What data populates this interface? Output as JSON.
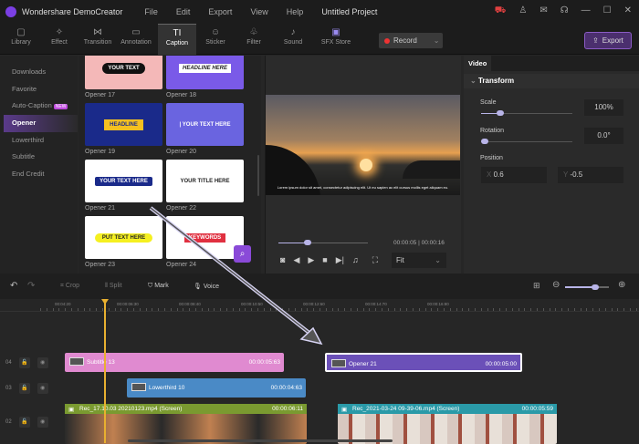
{
  "titlebar": {
    "app": "Wondershare DemoCreator",
    "menu": [
      "File",
      "Edit",
      "Export",
      "View",
      "Help"
    ],
    "project": "Untitled Project",
    "icons": [
      "cart-icon",
      "user-icon",
      "mail-icon",
      "support-icon",
      "minimize-icon",
      "maximize-icon",
      "close-icon"
    ]
  },
  "toolbar": {
    "tools": [
      {
        "label": "Library",
        "icon": "▢"
      },
      {
        "label": "Effect",
        "icon": "✧"
      },
      {
        "label": "Transition",
        "icon": "⋈"
      },
      {
        "label": "Annotation",
        "icon": "▭"
      },
      {
        "label": "Caption",
        "icon": "TI"
      },
      {
        "label": "Sticker",
        "icon": "☺"
      },
      {
        "label": "Filter",
        "icon": "♧"
      },
      {
        "label": "Sound",
        "icon": "♪"
      },
      {
        "label": "SFX Store",
        "icon": "▣"
      }
    ],
    "active": "Caption",
    "record": "Record",
    "export": "Export"
  },
  "sidebar": {
    "items": [
      "Downloads",
      "Favorite",
      "Auto-Caption",
      "Opener",
      "Lowerthird",
      "Subtitle",
      "End Credit"
    ],
    "new_badge": "NEW",
    "active": "Opener"
  },
  "cards": [
    {
      "label": "Opener 17",
      "text": "YOUR TEXT",
      "bg": "#f4b8b8",
      "fg": "#fff"
    },
    {
      "label": "Opener 18",
      "text": "HEADLINE HERE",
      "bg": "#7a5ae8",
      "fg": "#222"
    },
    {
      "label": "Opener 19",
      "text": "HEADLINE",
      "bg": "#1a2a8a",
      "fg": "#f5c020"
    },
    {
      "label": "Opener 20",
      "text": "| YOUR TEXT HERE",
      "bg": "#6a64e0",
      "fg": "#fff"
    },
    {
      "label": "Opener 21",
      "text": "YOUR TEXT HERE",
      "bg": "#ffffff",
      "fg": "#1a2a8a"
    },
    {
      "label": "Opener 22",
      "text": "YOUR TITLE HERE",
      "bg": "#ffffff",
      "fg": "#222"
    },
    {
      "label": "Opener 23",
      "text": "PUT TEXT HERE",
      "bg": "#ffffff",
      "fg": "#222"
    },
    {
      "label": "Opener 24",
      "text": "KEYWORDS",
      "bg": "#ffffff",
      "fg": "#e03040"
    }
  ],
  "preview": {
    "subtitle": "Lorem ipsum dolor sit amet, consectetur adipiscing elit. Ut eu sapien ac elit cursus mollis eget aliquam eu.",
    "current": "00:00:05",
    "total": "00:00:16",
    "progress": 0.33,
    "fit": "Fit"
  },
  "props": {
    "tab": "Video",
    "section": "Transform",
    "scale_label": "Scale",
    "scale": "100%",
    "rotation_label": "Rotation",
    "rotation": "0.0°",
    "position_label": "Position",
    "x_label": "X",
    "x": "0.6",
    "y_label": "Y",
    "y": "-0.5"
  },
  "timeline": {
    "tools": [
      "Crop",
      "Split",
      "Mark",
      "Voice"
    ],
    "ruler": [
      "00:04:20",
      "00:00:06:30",
      "00:00:08:40",
      "00:00:10:50",
      "00:00:12:60",
      "00:00:14:70",
      "00:00:16:80"
    ],
    "tracks": [
      "04",
      "03",
      "02"
    ],
    "clips": [
      {
        "name": "Subtitle 13",
        "dur": "00:00:05:63",
        "color": "#e08ad0"
      },
      {
        "name": "Opener 21",
        "dur": "00:00:05:00",
        "color": "#6b50b8"
      },
      {
        "name": "Lowerthird 10",
        "dur": "00:00:04:63",
        "color": "#4a8ac6"
      },
      {
        "name": "Rec_17.10.03 20210123.mp4 (Screen)",
        "dur": "00:00:06:11",
        "color": "#7a9a30"
      },
      {
        "name": "Rec_2021-03-24 09-39-06.mp4 (Screen)",
        "dur": "00:00:05:59",
        "color": "#2a9aa8"
      }
    ]
  }
}
